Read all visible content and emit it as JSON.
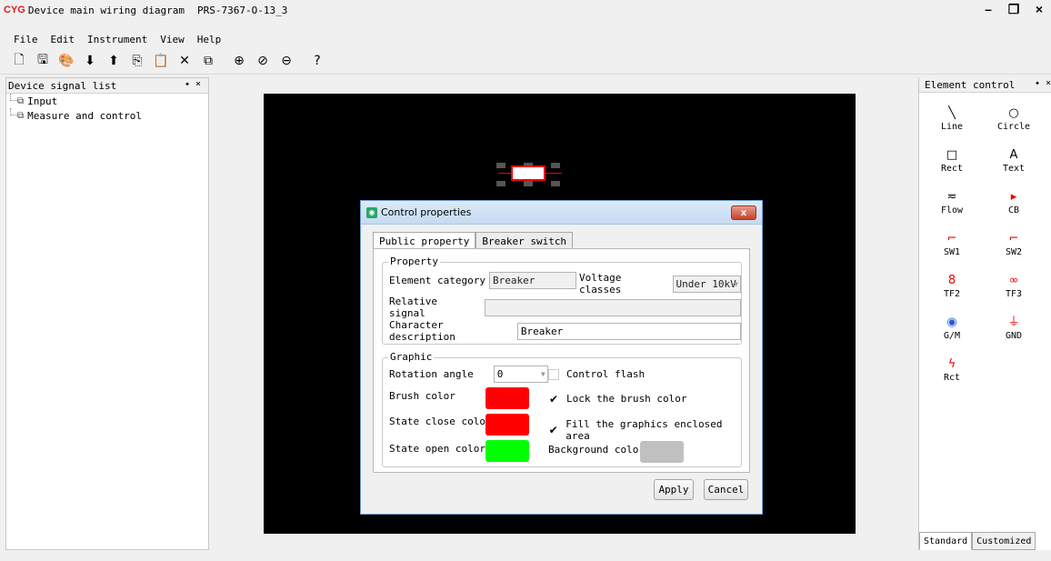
{
  "window": {
    "logo": "CYG",
    "title": "Device main wiring diagram",
    "document": "PRS-7367-O-13_3",
    "minimize": "–",
    "restore": "❐",
    "close": "×"
  },
  "menu": [
    "File",
    "Edit",
    "Instrument",
    "View",
    "Help"
  ],
  "toolbar": [
    {
      "name": "new-file-icon",
      "glyph": "🗋"
    },
    {
      "name": "save-icon",
      "glyph": "🖫"
    },
    {
      "name": "import-icon",
      "glyph": "🎨"
    },
    {
      "name": "download-icon",
      "glyph": "⬇"
    },
    {
      "name": "upload-icon",
      "glyph": "⬆"
    },
    {
      "name": "copy-icon",
      "glyph": "⎘"
    },
    {
      "name": "paste-icon",
      "glyph": "📋"
    },
    {
      "name": "delete-icon",
      "glyph": "✕"
    },
    {
      "name": "duplicate-icon",
      "glyph": "⧉"
    },
    {
      "name": "zoom-in-icon",
      "glyph": "⊕"
    },
    {
      "name": "zoom-fit-icon",
      "glyph": "⊘"
    },
    {
      "name": "zoom-out-icon",
      "glyph": "⊖"
    },
    {
      "name": "help-icon",
      "glyph": "?"
    }
  ],
  "left_panel": {
    "title": "Device signal list",
    "pin": "✦ ×",
    "items": [
      "Input",
      "Measure and control"
    ]
  },
  "right_panel": {
    "title": "Element control",
    "pin": "✦ ×",
    "elements": [
      {
        "label": "Line",
        "icon": "╲"
      },
      {
        "label": "Circle",
        "icon": "○"
      },
      {
        "label": "Rect",
        "icon": "□"
      },
      {
        "label": "Text",
        "icon": "A"
      },
      {
        "label": "Flow",
        "icon": "≂"
      },
      {
        "label": "CB",
        "icon": "▸"
      },
      {
        "label": "SW1",
        "icon": "⌐"
      },
      {
        "label": "SW2",
        "icon": "⌐"
      },
      {
        "label": "TF2",
        "icon": "8"
      },
      {
        "label": "TF3",
        "icon": "∞"
      },
      {
        "label": "G/M",
        "icon": "◉"
      },
      {
        "label": "GND",
        "icon": "⏚"
      },
      {
        "label": "Rct",
        "icon": "ϟ"
      }
    ],
    "tabs": [
      "Standard",
      "Customized"
    ]
  },
  "dialog": {
    "title": "Control properties",
    "close": "x",
    "tabs": [
      "Public property",
      "Breaker switch"
    ],
    "property_group": "Property",
    "element_category_label": "Element category",
    "element_category_value": "Breaker",
    "voltage_classes_label": "Voltage classes",
    "voltage_classes_value": "Under 10kV",
    "relative_signal_label": "Relative signal",
    "relative_signal_value": "",
    "character_description_label": "Character description",
    "character_description_value": "Breaker",
    "graphic_group": "Graphic",
    "rotation_angle_label": "Rotation angle",
    "rotation_angle_value": "0",
    "control_flash_label": "Control flash",
    "control_flash_checked": false,
    "brush_color_label": "Brush color",
    "brush_color": "#ff0000",
    "lock_brush_label": "Lock the brush color",
    "lock_brush_checked": true,
    "state_close_label": "State close color",
    "state_close_color": "#ff0000",
    "fill_area_label": "Fill the graphics enclosed area",
    "fill_area_checked": true,
    "state_open_label": "State open color",
    "state_open_color": "#00ff00",
    "background_color_label": "Background color",
    "background_color": "#c0c0c0",
    "apply": "Apply",
    "cancel": "Cancel"
  }
}
